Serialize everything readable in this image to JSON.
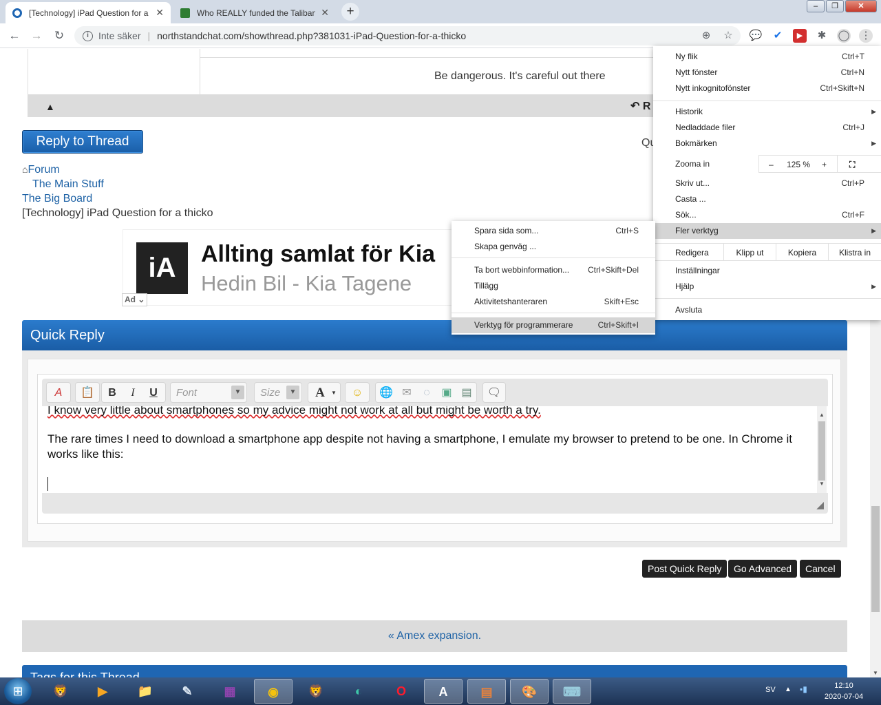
{
  "browser": {
    "tabs": [
      {
        "title": "[Technology] iPad Question for a thicko",
        "close": "✕"
      },
      {
        "title": "Who REALLY funded the Taliban",
        "close": "✕"
      }
    ],
    "new_tab": "+",
    "window_controls": {
      "minimize": "–",
      "maximize": "❐",
      "close": "✕"
    },
    "security_label": "Inte säker",
    "url": "northstandchat.com/showthread.php?381031-iPad-Question-for-a-thicko",
    "icons": [
      "back-icon",
      "forward-icon",
      "reload-icon",
      "info-icon",
      "zoom-icon",
      "star-icon",
      "extension-icons",
      "profile-icon",
      "more-menu-icon"
    ]
  },
  "post": {
    "signature": "Be dangerous. It's careful out there",
    "reply_post_label": "R"
  },
  "thread": {
    "reply_button": "Reply to Thread",
    "quote_label": "Qu",
    "breadcrumb": [
      "Forum",
      "The Main Stuff",
      "The Big Board"
    ],
    "current": "[Technology] iPad Question for a thicko"
  },
  "ad": {
    "logo_text": "iA",
    "title": "Allting samlat för Kia",
    "subtitle": "Hedin Bil - Kia Tagene",
    "badge": "Ad"
  },
  "quick_reply": {
    "header": "Quick Reply",
    "toolbar": {
      "font_placeholder": "Font",
      "size_placeholder": "Size",
      "bold": "B",
      "italic": "I",
      "underline": "U",
      "text_color": "A"
    },
    "text_line1": "I know very little about smartphones so my advice might not work at all but might be worth a try.",
    "text_line2": "The rare times I need to download a smartphone app despite not having a smartphone, I emulate my browser to pretend to be one. In Chrome it works like this:",
    "buttons": {
      "post": "Post Quick Reply",
      "advanced": "Go Advanced",
      "cancel": "Cancel"
    }
  },
  "thread_nav": {
    "prev": "« Amex expansion."
  },
  "tags_header": "Tags for this Thread",
  "chrome_menu": {
    "new_tab": {
      "label": "Ny flik",
      "shortcut": "Ctrl+T"
    },
    "new_window": {
      "label": "Nytt fönster",
      "shortcut": "Ctrl+N"
    },
    "incognito": {
      "label": "Nytt inkognitofönster",
      "shortcut": "Ctrl+Skift+N"
    },
    "history": {
      "label": "Historik"
    },
    "downloads": {
      "label": "Nedladdade filer",
      "shortcut": "Ctrl+J"
    },
    "bookmarks": {
      "label": "Bokmärken"
    },
    "zoom": {
      "label": "Zooma in",
      "minus": "–",
      "value": "125 %",
      "plus": "+"
    },
    "print": {
      "label": "Skriv ut...",
      "shortcut": "Ctrl+P"
    },
    "cast": {
      "label": "Casta ..."
    },
    "find": {
      "label": "Sök...",
      "shortcut": "Ctrl+F"
    },
    "more_tools": {
      "label": "Fler verktyg"
    },
    "edit": {
      "label": "Redigera",
      "cut": "Klipp ut",
      "copy": "Kopiera",
      "paste": "Klistra in"
    },
    "settings": {
      "label": "Inställningar"
    },
    "help": {
      "label": "Hjälp"
    },
    "exit": {
      "label": "Avsluta"
    }
  },
  "more_tools_menu": {
    "save_page": {
      "label": "Spara sida som...",
      "shortcut": "Ctrl+S"
    },
    "create_shortcut": {
      "label": "Skapa genväg ..."
    },
    "clear_data": {
      "label": "Ta bort webbinformation...",
      "shortcut": "Ctrl+Skift+Del"
    },
    "extensions": {
      "label": "Tillägg"
    },
    "task_manager": {
      "label": "Aktivitetshanteraren",
      "shortcut": "Skift+Esc"
    },
    "dev_tools": {
      "label": "Verktyg för programmerare",
      "shortcut": "Ctrl+Skift+I"
    }
  },
  "taskbar": {
    "lang": "SV",
    "time": "12:10",
    "date": "2020-07-04",
    "apps": [
      "brave",
      "media-player",
      "explorer",
      "paint-tool",
      "winrar",
      "chrome",
      "brave",
      "edge",
      "opera",
      "word-doc",
      "presentation",
      "paint",
      "remote-desktop"
    ]
  },
  "colors": {
    "accent_blue": "#1f66b3",
    "link": "#1f63a6",
    "menu_highlight": "#d5d5d5"
  }
}
